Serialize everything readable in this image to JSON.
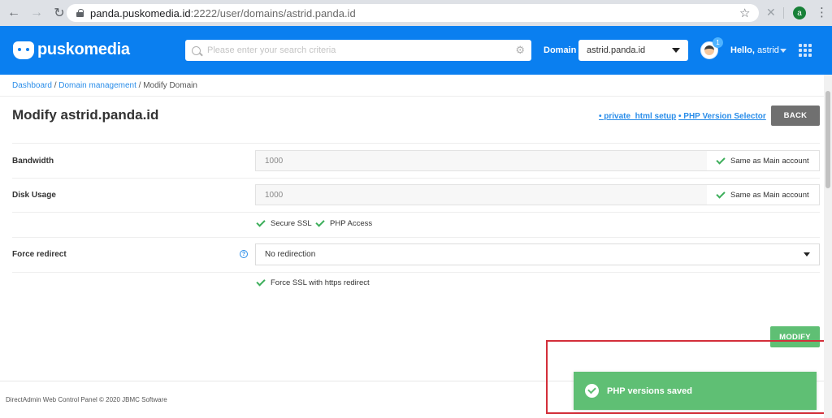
{
  "browser": {
    "url_host": "panda.puskomedia.id",
    "url_path": ":2222/user/domains/astrid.panda.id",
    "profile_initial": "a"
  },
  "header": {
    "logo_text": "puskomedia",
    "search_placeholder": "Please enter your search criteria",
    "domain_label": "Domain",
    "domain_value": "astrid.panda.id",
    "notification_count": "1",
    "hello_prefix": "Hello,",
    "username": "astrid"
  },
  "breadcrumb": {
    "items": [
      "Dashboard",
      "Domain management",
      "Modify Domain"
    ]
  },
  "page": {
    "title": "Modify astrid.panda.id",
    "link_private_html": "• private_html setup",
    "link_php_selector": "• PHP Version Selector",
    "back_label": "BACK"
  },
  "form": {
    "bandwidth_label": "Bandwidth",
    "bandwidth_value": "1000",
    "bandwidth_same": "Same as Main account",
    "disk_label": "Disk Usage",
    "disk_value": "1000",
    "disk_same": "Same as Main account",
    "secure_ssl": "Secure SSL",
    "php_access": "PHP Access",
    "redirect_label": "Force redirect",
    "redirect_value": "No redirection",
    "force_ssl": "Force SSL with https redirect",
    "modify_label": "MODIFY"
  },
  "footer": {
    "text": "DirectAdmin Web Control Panel © 2020 JBMC Software"
  },
  "toast": {
    "message": "PHP versions saved"
  },
  "colors": {
    "primary": "#0a7ff0",
    "success": "#5fbf74",
    "highlight": "#d32f3a",
    "link": "#2a8de9"
  }
}
